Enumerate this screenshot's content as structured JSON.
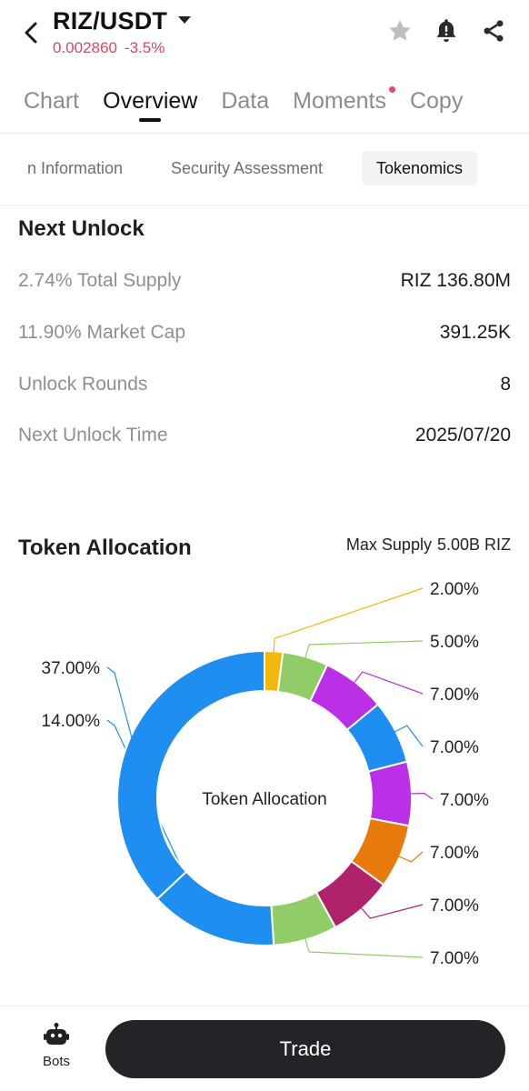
{
  "header": {
    "pair": "RIZ/USDT",
    "price": "0.002860",
    "change": "-3.5%",
    "price_color": "#e0455a",
    "icons": [
      "back-icon",
      "star-icon",
      "bell-icon",
      "share-icon"
    ]
  },
  "tabs": [
    {
      "label": "Chart",
      "active": false
    },
    {
      "label": "Overview",
      "active": true
    },
    {
      "label": "Data",
      "active": false
    },
    {
      "label": "Moments",
      "active": false,
      "dot": true
    },
    {
      "label": "Copy",
      "active": false
    }
  ],
  "subtabs": [
    {
      "label": "Token Information",
      "visible_label": "n Information",
      "active": false
    },
    {
      "label": "Security Assessment",
      "active": false
    },
    {
      "label": "Tokenomics",
      "active": true
    }
  ],
  "next_unlock": {
    "title": "Next Unlock",
    "rows": [
      {
        "label": "2.74% Total Supply",
        "value": "RIZ 136.80M"
      },
      {
        "label": "11.90% Market Cap",
        "value": "391.25K"
      },
      {
        "label": "Unlock Rounds",
        "value": "8"
      },
      {
        "label": "Next Unlock Time",
        "value": "2025/07/20"
      }
    ]
  },
  "token_allocation": {
    "title": "Token Allocation",
    "max_supply_label": "Max Supply",
    "max_supply_value": "5.00B RIZ"
  },
  "chart_data": {
    "type": "pie",
    "title": "Token Allocation",
    "center_label": "Token Allocation",
    "donut": true,
    "slices": [
      {
        "label": "2.00%",
        "value": 2,
        "color": "#f2b90c"
      },
      {
        "label": "5.00%",
        "value": 5,
        "color": "#90cd68"
      },
      {
        "label": "7.00%",
        "value": 7,
        "color": "#bb2fe6"
      },
      {
        "label": "7.00%",
        "value": 7,
        "color": "#1f8ef1"
      },
      {
        "label": "7.00%",
        "value": 7,
        "color": "#bb2fe6"
      },
      {
        "label": "7.00%",
        "value": 7,
        "color": "#e87a0b"
      },
      {
        "label": "7.00%",
        "value": 7,
        "color": "#b0236a"
      },
      {
        "label": "7.00%",
        "value": 7,
        "color": "#90cd68"
      },
      {
        "label": "14.00%",
        "value": 14,
        "color": "#1f8ef1"
      },
      {
        "label": "37.00%",
        "value": 37,
        "color": "#1f8ef1"
      }
    ]
  },
  "bottom_bar": {
    "bots_label": "Bots",
    "trade_label": "Trade"
  }
}
